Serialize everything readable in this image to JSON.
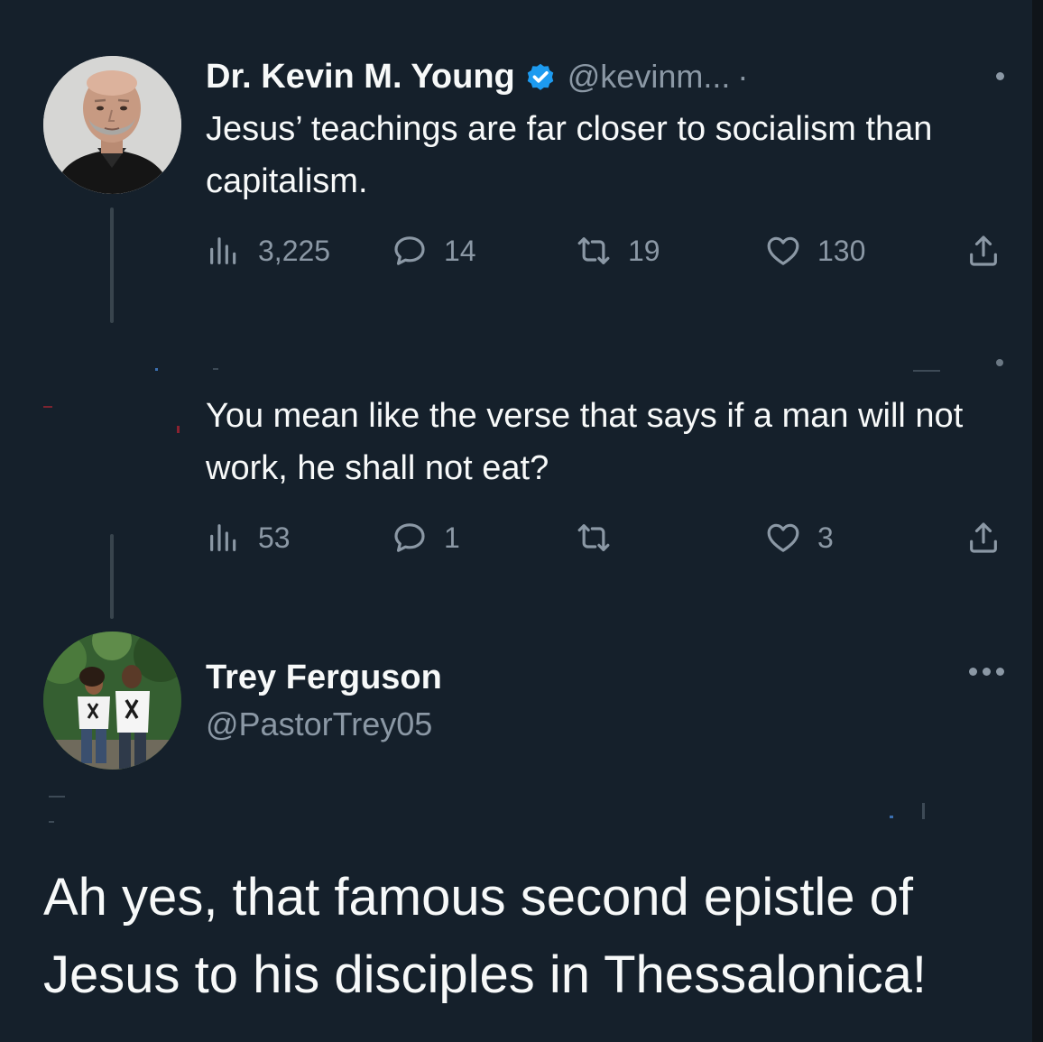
{
  "tweet1": {
    "name": "Dr. Kevin M. Young",
    "handle": "@kevinm...",
    "separator": "·",
    "text": "Jesus’ teachings are far closer to socialism than capitalism.",
    "views": "3,225",
    "replies": "14",
    "retweets": "19",
    "likes": "130"
  },
  "tweet2": {
    "text": "You mean like the verse that says if a man will not work, he shall not eat?",
    "views": "53",
    "replies": "1",
    "retweets": "",
    "likes": "3"
  },
  "tweet3": {
    "name": "Trey Ferguson",
    "handle": "@PastorTrey05",
    "text": "Ah yes, that famous second epistle of Jesus to his disciples in Thessalonica!"
  },
  "colors": {
    "background": "#15202b",
    "text_primary": "#f7f9f9",
    "text_secondary": "#8b98a5",
    "verified": "#1d9bf0",
    "thread_line": "#38444d"
  },
  "icons": {
    "verified": "verified-badge-icon",
    "views": "analytics-icon",
    "reply": "reply-icon",
    "retweet": "retweet-icon",
    "like": "heart-icon",
    "share": "share-icon",
    "more": "more-icon"
  }
}
